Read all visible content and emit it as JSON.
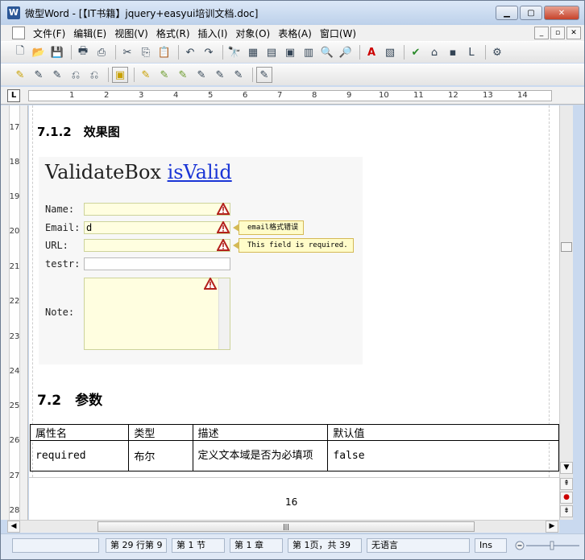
{
  "window": {
    "app_icon": "W",
    "title": "微型Word - [【IT书籍】jquery+easyui培训文档.doc]",
    "min_icon": "minimize-icon",
    "max_icon": "maximize-icon",
    "close_label": "✕"
  },
  "menu": {
    "items": [
      "文件(F)",
      "编辑(E)",
      "视图(V)",
      "格式(R)",
      "插入(I)",
      "对象(O)",
      "表格(A)",
      "窗口(W)"
    ],
    "mdi_buttons": [
      "_",
      "▫",
      "✕"
    ]
  },
  "toolbar1": {
    "icons": [
      "new-doc-icon",
      "open-icon",
      "save-icon",
      "print-icon",
      "pdf-icon",
      "cut-icon",
      "copy-icon",
      "paste-icon",
      "undo-icon",
      "redo-icon",
      "find-icon",
      "table-icon",
      "insert-icon",
      "page-icon",
      "columns-icon",
      "zoom-icon",
      "spell-icon",
      "font-color-icon",
      "text-icon",
      "abc-check-icon",
      "format-painter-icon",
      "box-icon",
      "l-icon",
      "stamp-icon"
    ],
    "glyphs": [
      "🗋",
      "📂",
      "💾",
      "🖶",
      "⎙",
      "✂",
      "⎘",
      "📋",
      "↶",
      "↷",
      "🔭",
      "▦",
      "▤",
      "▣",
      "▥",
      "🔍",
      "🔎",
      "A",
      "▧",
      "✔",
      "⌂",
      "▪",
      "L",
      "⚙"
    ]
  },
  "toolbar2": {
    "glyphs": [
      "✎",
      "✎",
      "✎",
      "⎌",
      "⎌",
      "▣",
      "✎",
      "✎",
      "✎",
      "✎",
      "✎",
      "✎",
      "✎"
    ]
  },
  "ruler": {
    "ticks": [
      "1",
      "2",
      "3",
      "4",
      "5",
      "6",
      "7",
      "8",
      "9",
      "10",
      "11",
      "12",
      "13",
      "14"
    ],
    "tab_marker": "L"
  },
  "vruler": {
    "numbers": [
      "17",
      "18",
      "19",
      "20",
      "21",
      "22",
      "23",
      "24",
      "25",
      "26",
      "27",
      "28"
    ]
  },
  "document": {
    "heading_712": "7.1.2　效果图",
    "figure": {
      "title_plain": "ValidateBox ",
      "title_link": "isValid",
      "labels": [
        "Name:",
        "Email:",
        "URL:",
        "testr:",
        "Note:"
      ],
      "email_value": "d",
      "tip_email": "email格式错误",
      "tip_url": "This field is required."
    },
    "heading_72": "7.2　参数",
    "table": {
      "headers": [
        "属性名",
        "类型",
        "描述",
        "默认值"
      ],
      "row": [
        "required",
        "布尔",
        "定义文本域是否为必填项",
        "false"
      ]
    },
    "page_number": "16"
  },
  "scroll": {
    "up": "▲",
    "down": "▼",
    "page_prev": "⇞",
    "page_dot": "●",
    "page_next": "⇟",
    "hthumb_grip": "|||"
  },
  "status": {
    "line": "第 29 行第 9",
    "section": "第 1 节",
    "chapter": "第 1 章",
    "page": "第 1页，共 39",
    "lang": "无语言",
    "mode": "Ins"
  }
}
